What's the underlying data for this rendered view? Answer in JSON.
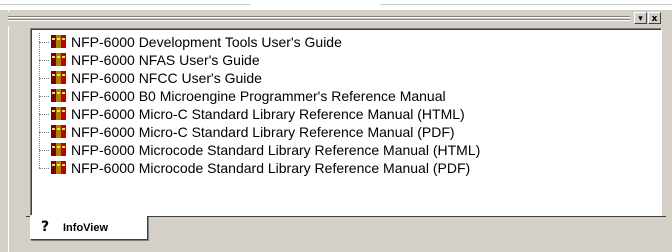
{
  "pane": {
    "minimize_glyph": "▾",
    "close_glyph": "x"
  },
  "tree": {
    "items": [
      {
        "label": "NFP-6000 Development Tools User's Guide",
        "icon": "books-icon"
      },
      {
        "label": "NFP-6000 NFAS User's Guide",
        "icon": "books-icon"
      },
      {
        "label": "NFP-6000 NFCC User's Guide",
        "icon": "books-icon"
      },
      {
        "label": "NFP-6000 B0 Microengine Programmer's Reference Manual",
        "icon": "books-icon"
      },
      {
        "label": "NFP-6000 Micro-C Standard Library Reference Manual (HTML)",
        "icon": "books-icon"
      },
      {
        "label": "NFP-6000 Micro-C Standard Library Reference Manual (PDF)",
        "icon": "books-icon"
      },
      {
        "label": "NFP-6000 Microcode Standard Library Reference Manual (HTML)",
        "icon": "books-icon"
      },
      {
        "label": "NFP-6000 Microcode Standard Library Reference Manual (PDF)",
        "icon": "books-icon"
      }
    ]
  },
  "tabs": {
    "active": {
      "label": "InfoView",
      "icon": "help-question-icon",
      "icon_glyph": "?"
    }
  }
}
